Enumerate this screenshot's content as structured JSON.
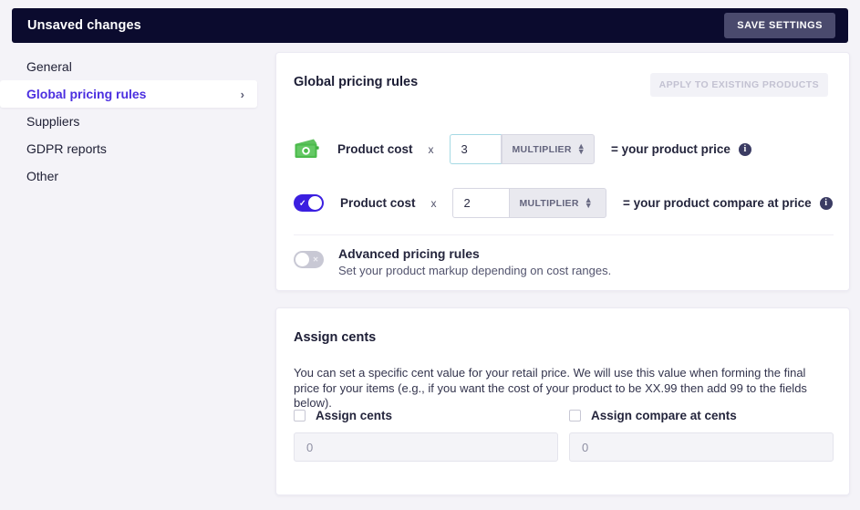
{
  "savebar": {
    "title": "Unsaved changes",
    "save_label": "SAVE SETTINGS",
    "bg_color": "#0b0b2e",
    "button_color": "#4a4a6d"
  },
  "sidebar": {
    "items": [
      {
        "label": "General",
        "active": false
      },
      {
        "label": "Global pricing rules",
        "active": true,
        "chevron": "›"
      },
      {
        "label": "Suppliers",
        "active": false
      },
      {
        "label": "GDPR reports",
        "active": false
      },
      {
        "label": "Other",
        "active": false
      }
    ],
    "active_color": "#4b2fe0"
  },
  "pricing_card": {
    "title": "Global pricing rules",
    "apply_label": "APPLY TO EXISTING PRODUCTS",
    "rows": [
      {
        "icon": "wallet-icon",
        "label": "Product cost",
        "operator": "x",
        "value": "3",
        "unit": "MULTIPLIER",
        "result": "= your product price",
        "info": "i",
        "focused": true
      },
      {
        "icon": "toggle-on",
        "label": "Product cost",
        "operator": "x",
        "value": "2",
        "unit": "MULTIPLIER",
        "result": "= your product compare at price",
        "info": "i",
        "focused": false
      }
    ],
    "advanced": {
      "toggle_state": "off",
      "toggle_mark": "×",
      "title": "Advanced pricing rules",
      "subtitle": "Set your product markup depending on cost ranges."
    }
  },
  "cents_card": {
    "title": "Assign cents",
    "description": "You can set a specific cent value for your retail price. We will use this value when forming the final price for your items (e.g., if you want the cost of your product to be XX.99 then add 99 to the fields below).",
    "columns": [
      {
        "checkbox_label": "Assign cents",
        "checked": false,
        "input_value": "0"
      },
      {
        "checkbox_label": "Assign compare at cents",
        "checked": false,
        "input_value": "0"
      }
    ]
  }
}
